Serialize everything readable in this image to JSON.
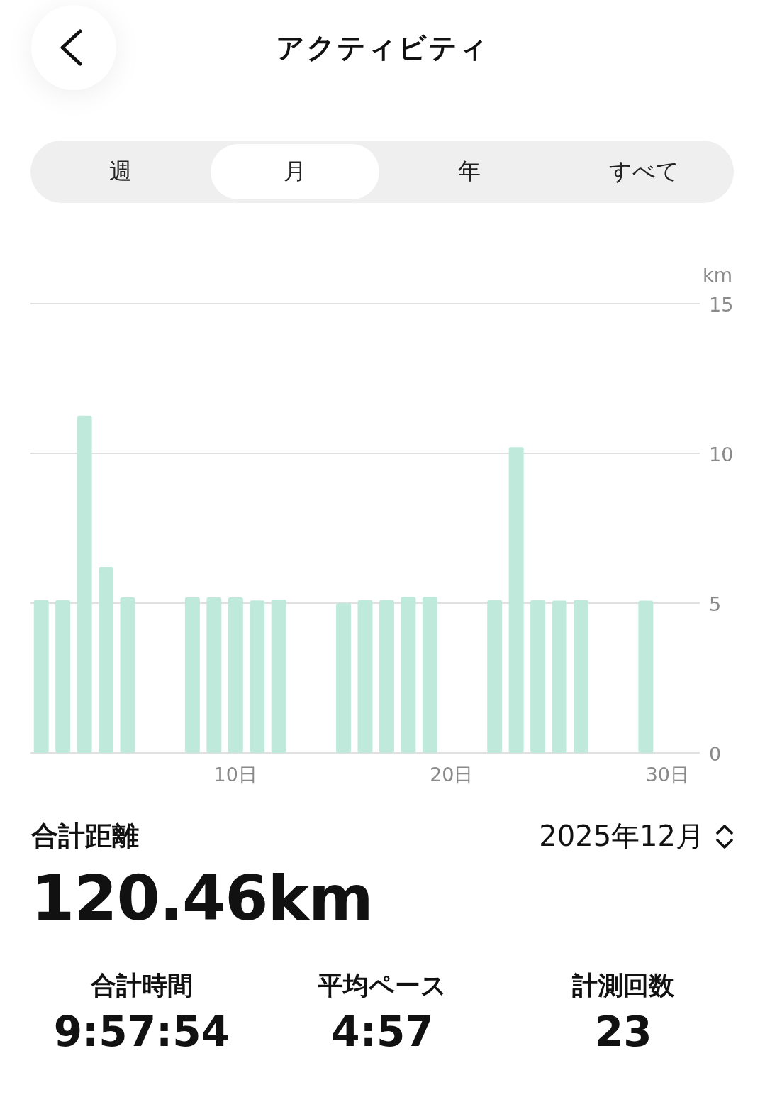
{
  "header": {
    "title": "アクティビティ"
  },
  "tabs": [
    {
      "label": "週",
      "selected": false
    },
    {
      "label": "月",
      "selected": true
    },
    {
      "label": "年",
      "selected": false
    },
    {
      "label": "すべて",
      "selected": false
    }
  ],
  "chart": {
    "chart_data": {
      "type": "bar",
      "ylabel": "km",
      "x": [
        1,
        2,
        3,
        4,
        5,
        8,
        9,
        10,
        11,
        12,
        15,
        16,
        17,
        18,
        19,
        22,
        23,
        24,
        25,
        26,
        29
      ],
      "series": [
        {
          "color": "#bfeadb",
          "values": [
            5.1,
            5.1,
            11.26,
            6.21,
            5.19,
            5.19,
            5.19,
            5.19,
            5.09,
            5.12,
            5.0,
            5.1,
            5.1,
            5.21,
            5.21,
            5.1,
            10.21,
            5.1,
            5.08,
            5.1,
            5.08
          ]
        }
      ],
      "xlim": [
        0.5,
        31.5
      ],
      "ylim": [
        0,
        15
      ],
      "yticks": [
        0,
        5,
        10,
        15
      ],
      "xticks": [
        {
          "value": 10,
          "label": "10日"
        },
        {
          "value": 20,
          "label": "20日"
        },
        {
          "value": 30,
          "label": "30日"
        }
      ]
    }
  },
  "summary": {
    "label": "合計距離",
    "value": "120.46km",
    "period": "2025年12月"
  },
  "stats": [
    {
      "label": "合計時間",
      "value": "9:57:54"
    },
    {
      "label": "平均ペース",
      "value": "4:57"
    },
    {
      "label": "計測回数",
      "value": "23"
    }
  ]
}
